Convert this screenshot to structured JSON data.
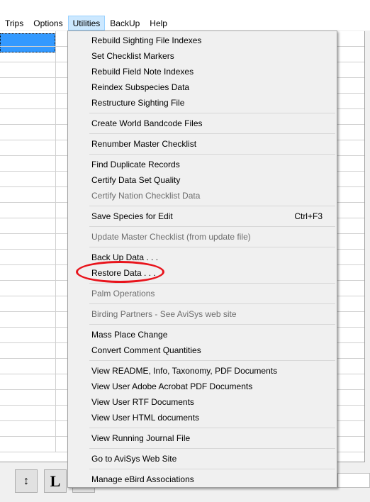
{
  "menubar": {
    "items": [
      {
        "label": "Trips"
      },
      {
        "label": "Options"
      },
      {
        "label": "Utilities",
        "active": true
      },
      {
        "label": "BackUp"
      },
      {
        "label": "Help"
      }
    ]
  },
  "utilities_menu": {
    "groups": [
      [
        {
          "label": "Rebuild Sighting File Indexes"
        },
        {
          "label": "Set Checklist Markers"
        },
        {
          "label": "Rebuild Field Note Indexes"
        },
        {
          "label": "Reindex Subspecies Data"
        },
        {
          "label": "Restructure Sighting File"
        }
      ],
      [
        {
          "label": "Create World Bandcode Files"
        }
      ],
      [
        {
          "label": "Renumber Master Checklist"
        }
      ],
      [
        {
          "label": "Find Duplicate Records"
        },
        {
          "label": "Certify Data Set Quality"
        },
        {
          "label": "Certify Nation Checklist Data",
          "disabled": true
        }
      ],
      [
        {
          "label": "Save Species for Edit",
          "shortcut": "Ctrl+F3"
        }
      ],
      [
        {
          "label": "Update Master Checklist (from update file)",
          "disabled": true
        }
      ],
      [
        {
          "label": "Back Up Data . . ."
        },
        {
          "label": "Restore Data . . .",
          "highlighted_annotation": true
        }
      ],
      [
        {
          "label": "Palm Operations",
          "disabled": true
        }
      ],
      [
        {
          "label": "Birding Partners - See AviSys web site",
          "disabled": true
        }
      ],
      [
        {
          "label": "Mass Place Change"
        },
        {
          "label": "Convert Comment Quantities"
        }
      ],
      [
        {
          "label": "View README, Info, Taxonomy, PDF Documents"
        },
        {
          "label": "View User Adobe Acrobat PDF Documents"
        },
        {
          "label": "View User RTF Documents"
        },
        {
          "label": "View User HTML documents"
        }
      ],
      [
        {
          "label": "View Running Journal File"
        }
      ],
      [
        {
          "label": "Go to AviSys Web Site"
        }
      ],
      [
        {
          "label": "Manage eBird Associations"
        }
      ]
    ]
  },
  "toolbar": {
    "buttons": [
      {
        "icon": "up-down-arrow-icon"
      },
      {
        "label": "L"
      }
    ]
  },
  "colors": {
    "selection": "#3399ff",
    "annotation": "#e8141c",
    "menu_active": "#cce8ff"
  }
}
